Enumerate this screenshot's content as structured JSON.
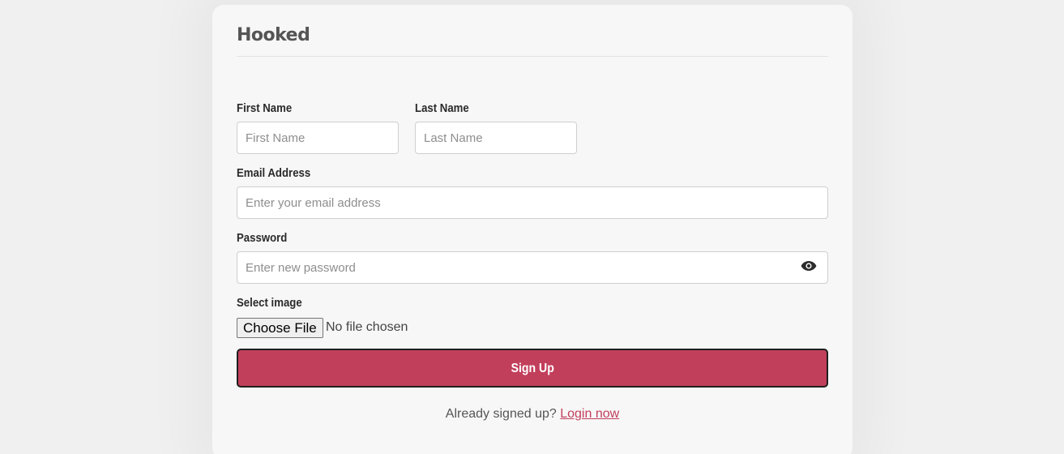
{
  "brand": {
    "name": "Hooked"
  },
  "form": {
    "first_name": {
      "label": "First Name",
      "placeholder": "First Name",
      "value": ""
    },
    "last_name": {
      "label": "Last Name",
      "placeholder": "Last Name",
      "value": ""
    },
    "email": {
      "label": "Email Address",
      "placeholder": "Enter your email address",
      "value": ""
    },
    "password": {
      "label": "Password",
      "placeholder": "Enter new password",
      "value": "",
      "toggle_icon": "eye-icon"
    },
    "image": {
      "label": "Select image",
      "button_label": "Choose File",
      "status": "No file chosen"
    },
    "submit_label": "Sign Up"
  },
  "footer": {
    "prompt": "Already signed up?",
    "link_label": "Login now"
  },
  "colors": {
    "accent": "#c23f5c",
    "card": "#f7f7f7",
    "background": "#f0f0f0"
  }
}
